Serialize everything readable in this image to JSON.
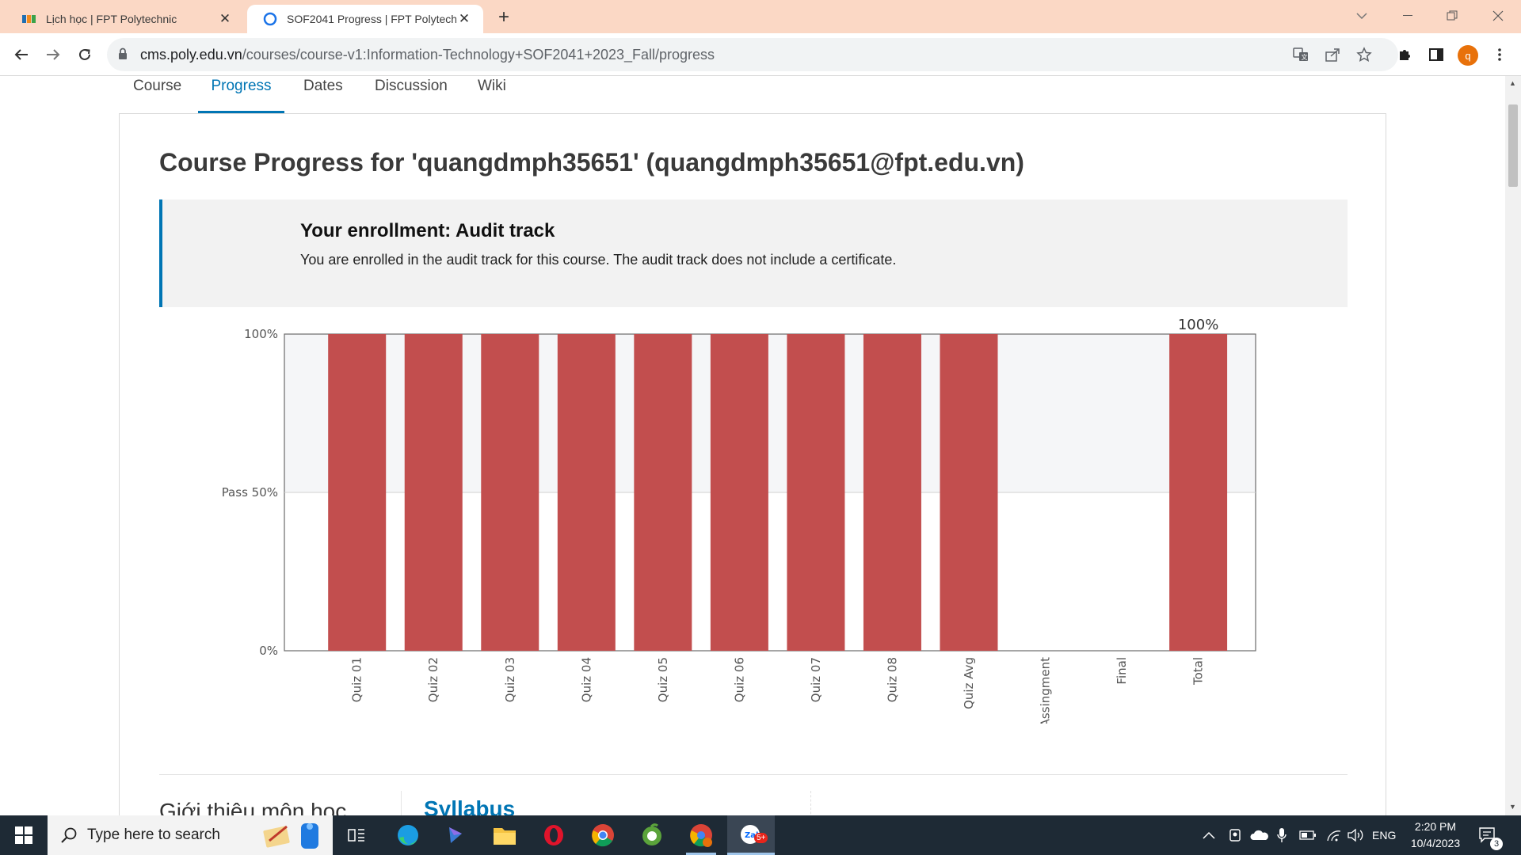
{
  "browser": {
    "tabs": [
      {
        "title": "Lịch học | FPT Polytechnic",
        "active": false
      },
      {
        "title": "SOF2041 Progress | FPT Polytech",
        "active": true
      }
    ],
    "new_tab_label": "+",
    "url_host": "cms.poly.edu.vn",
    "url_path": "/courses/course-v1:Information-Technology+SOF2041+2023_Fall/progress",
    "profile_initial": "q",
    "accent_color": "#e8710a"
  },
  "course_nav": {
    "tabs": [
      "Course",
      "Progress",
      "Dates",
      "Discussion",
      "Wiki"
    ],
    "active": "Progress"
  },
  "progress": {
    "title": "Course Progress for 'quangdmph35651' (quangdmph35651@fpt.edu.vn)",
    "enrollment_heading": "Your enrollment: Audit track",
    "enrollment_text": "You are enrolled in the audit track for this course. The audit track does not include a certificate."
  },
  "chart_data": {
    "type": "bar",
    "categories": [
      "Quiz 01",
      "Quiz 02",
      "Quiz 03",
      "Quiz 04",
      "Quiz 05",
      "Quiz 06",
      "Quiz 07",
      "Quiz 08",
      "Quiz Avg",
      "Assingment",
      "Final",
      "Total"
    ],
    "values": [
      100,
      100,
      100,
      100,
      100,
      100,
      100,
      100,
      100,
      0,
      0,
      100
    ],
    "ylim": [
      0,
      100
    ],
    "y_ticks": [
      {
        "value": 0,
        "label": "0%"
      },
      {
        "value": 50,
        "label": "Pass 50%"
      },
      {
        "value": 100,
        "label": "100%"
      }
    ],
    "pass_threshold": 50,
    "total_label": "100%",
    "bar_color": "#c24e4e",
    "band_color": "#f5f6f8",
    "title": "",
    "xlabel": "",
    "ylabel": ""
  },
  "sections": {
    "left_heading": "Giới thiệu môn học",
    "right_heading": "Syllabus"
  },
  "taskbar": {
    "search_placeholder": "Type here to search",
    "language": "ENG",
    "time": "2:20 PM",
    "date": "10/4/2023",
    "notification_count": "3",
    "badge_count": "5+"
  }
}
